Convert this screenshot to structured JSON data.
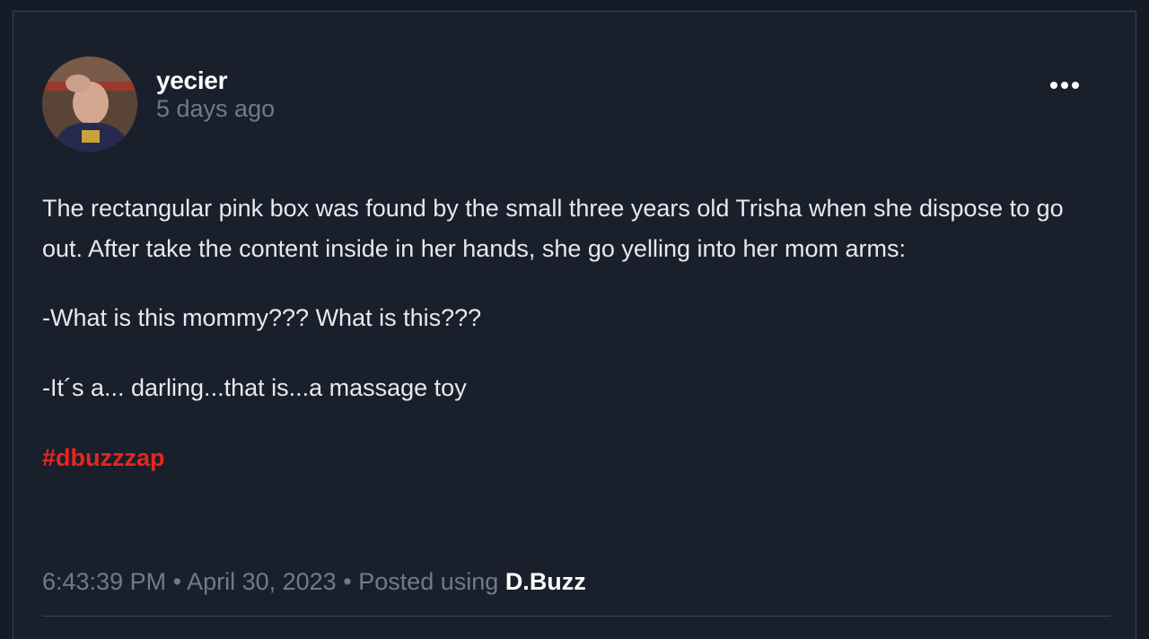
{
  "post": {
    "author": {
      "username": "yecier",
      "posted_ago": "5 days ago"
    },
    "paragraphs": [
      "The rectangular pink box was found by the small three years old Trisha when she dispose to go out. After take the content inside in her hands, she go yelling into her mom arms:",
      "-What is this mommy??? What is this???",
      "-It´s a... darling...that is...a massage toy"
    ],
    "hashtag": "#dbuzzzap",
    "footer": {
      "time": "6:43:39 PM",
      "separator": "•",
      "date": "April 30, 2023",
      "posted_using_label": "Posted using",
      "app_name": "D.Buzz"
    },
    "menu_icon": "more-horizontal-icon"
  },
  "colors": {
    "background": "#151c28",
    "card": "#19202b",
    "muted_text": "#6f7b8a",
    "hashtag": "#e8251f"
  }
}
